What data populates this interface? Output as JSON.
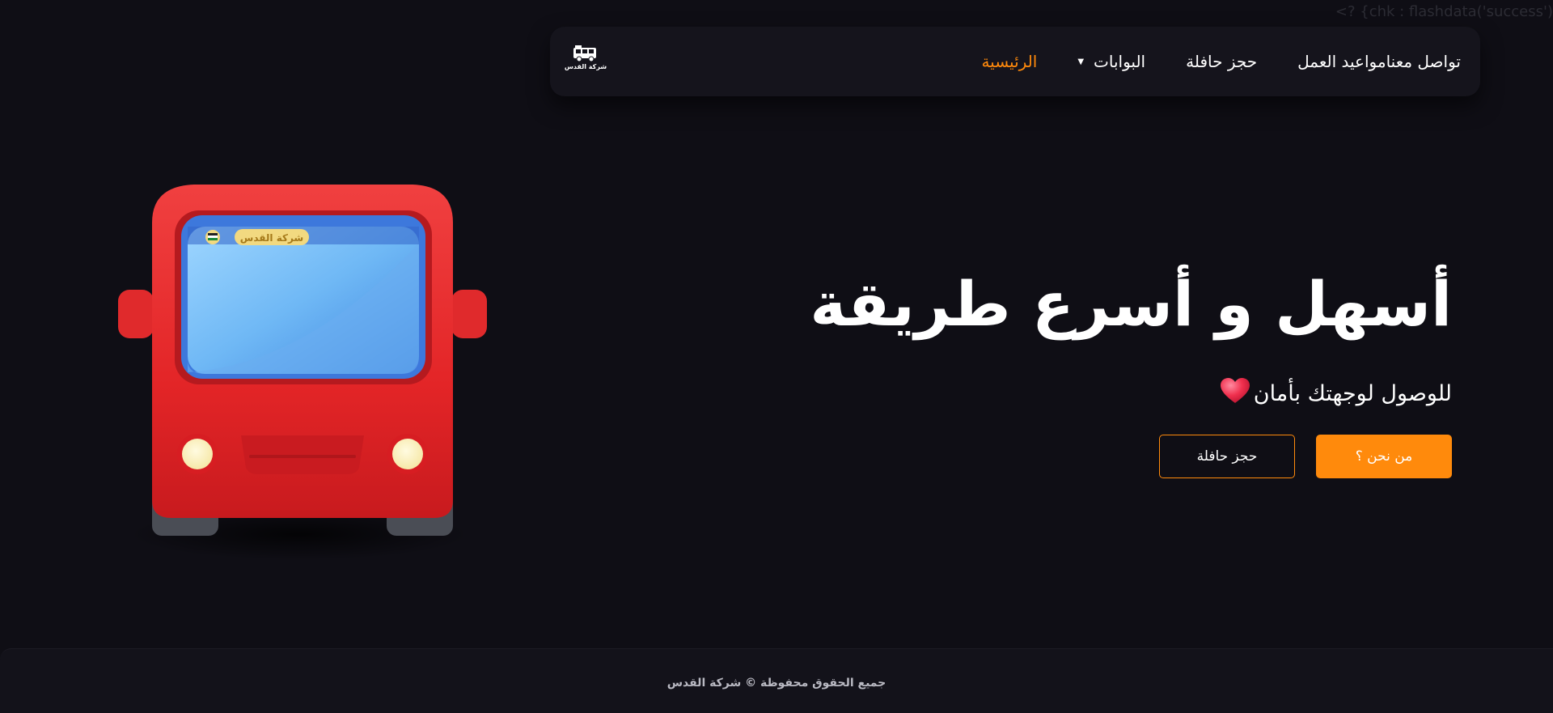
{
  "debug_text": "<? {chk : flashdata('success')",
  "logo": {
    "text": "شركة القدس"
  },
  "nav": {
    "items": [
      {
        "label": "الرئيسية",
        "active": true
      },
      {
        "label": "البوابات",
        "dropdown": true
      },
      {
        "label": "حجز حافلة"
      },
      {
        "label": "مواعيد العمل"
      },
      {
        "label": "تواصل معنا"
      }
    ]
  },
  "hero": {
    "title": "أسهل و أسرع طريقة",
    "subtitle": "للوصول لوجهتك بأمان",
    "primary_button": "من نحن ؟",
    "secondary_button": "حجز حافلة"
  },
  "bus": {
    "sign_text": "شركة القدس"
  },
  "footer": {
    "text": "جميع الحقوق محفوظة © شركة القدس"
  },
  "colors": {
    "accent": "#ff8a0c",
    "background": "#0f0e15",
    "navbar": "#15141c",
    "bus_red": "#e8282a"
  }
}
